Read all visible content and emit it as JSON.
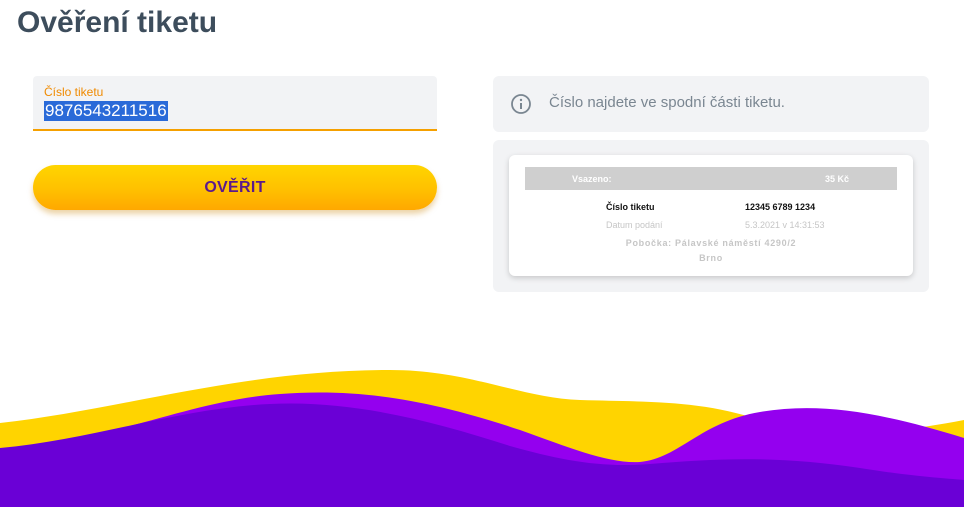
{
  "page": {
    "title": "Ověření tiketu"
  },
  "form": {
    "ticket_label": "Číslo tiketu",
    "ticket_value": "9876543211516",
    "verify_label": "OVĚŘIT"
  },
  "info": {
    "icon": "info-icon",
    "text": "Číslo najdete ve spodní části tiketu."
  },
  "ticket_preview": {
    "header_label": "Vsazeno:",
    "header_value": "35 Kč",
    "number_label": "Číslo tiketu",
    "number_value": "12345 6789 1234",
    "date_label": "Datum podání",
    "date_value": "5.3.2021 v 14:31:53",
    "branch_line1": "Pobočka: Pálavské náměstí 4290/2",
    "branch_line2": "Brno"
  },
  "colors": {
    "accent_yellow": "#ffd400",
    "accent_orange": "#f5a000",
    "purple_light": "#9400ef",
    "purple_dark": "#6a00d6",
    "title": "#3d4d5c"
  }
}
